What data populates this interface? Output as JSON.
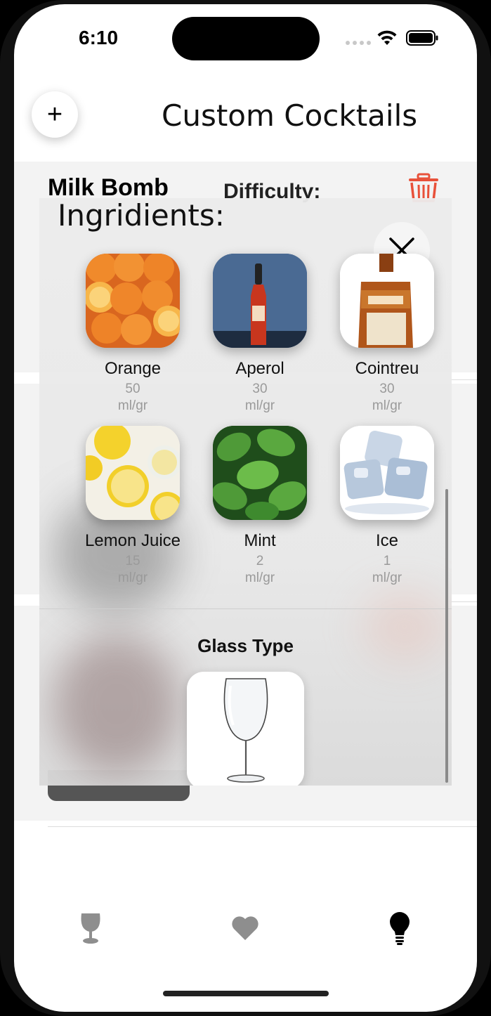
{
  "status_bar": {
    "time": "6:10"
  },
  "header": {
    "title": "Custom Cocktails",
    "add_label": "+"
  },
  "background_card": {
    "name": "Milk Bomb",
    "difficulty_label": "Difficulty:"
  },
  "ingredients_sheet": {
    "title": "Ingridients:",
    "items": [
      {
        "name": "Orange",
        "amount": "50",
        "unit": "ml/gr",
        "image": "orange-slices"
      },
      {
        "name": "Aperol",
        "amount": "30",
        "unit": "ml/gr",
        "image": "aperol-bottle"
      },
      {
        "name": "Cointreu",
        "amount": "30",
        "unit": "ml/gr",
        "image": "cointreau-bottle"
      },
      {
        "name": "Lemon Juice",
        "amount": "15",
        "unit": "ml/gr",
        "image": "lemon-halves"
      },
      {
        "name": "Mint",
        "amount": "2",
        "unit": "ml/gr",
        "image": "mint-leaves"
      },
      {
        "name": "Ice",
        "amount": "1",
        "unit": "ml/gr",
        "image": "ice-cubes"
      }
    ],
    "glass_type_label": "Glass Type",
    "glass_image": "wine-glass"
  },
  "tab_bar": {
    "items": [
      {
        "icon": "wine-glass-icon",
        "active": false
      },
      {
        "icon": "heart-icon",
        "active": false
      },
      {
        "icon": "lightbulb-icon",
        "active": true
      }
    ]
  },
  "colors": {
    "trash": "#e8513a",
    "inactive_tab": "#8e8e8e",
    "active_tab": "#000000"
  }
}
